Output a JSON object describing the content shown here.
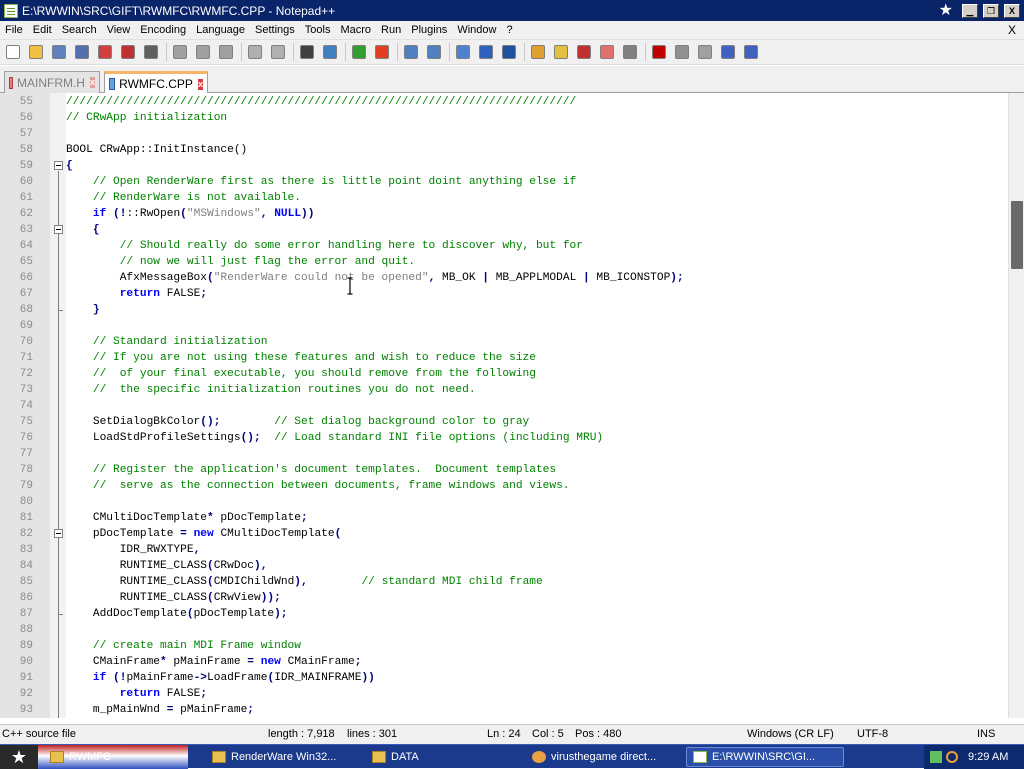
{
  "window": {
    "title": "E:\\RWWIN\\SRC\\GIFT\\RWMFC\\RWMFC.CPP - Notepad++",
    "close_glyph": "X"
  },
  "menu": [
    "File",
    "Edit",
    "Search",
    "View",
    "Encoding",
    "Language",
    "Settings",
    "Tools",
    "Macro",
    "Run",
    "Plugins",
    "Window",
    "?"
  ],
  "menu_close": "X",
  "toolbar_icons": [
    "new-file-icon",
    "open-file-icon",
    "save-icon",
    "save-all-icon",
    "close-icon",
    "close-all-icon",
    "print-icon",
    "cut-icon",
    "copy-icon",
    "paste-icon",
    "undo-icon",
    "redo-icon",
    "find-icon",
    "replace-icon",
    "zoom-in-icon",
    "zoom-out-icon",
    "sync-vertical-icon",
    "sync-horizontal-icon",
    "word-wrap-icon",
    "show-all-chars-icon",
    "indent-guide-icon",
    "user-define-language-icon",
    "doc-map-icon",
    "function-list-icon",
    "folder-as-workspace-icon",
    "monitoring-icon",
    "record-macro-icon",
    "stop-record-icon",
    "play-macro-icon",
    "play-multiple-icon",
    "save-macro-icon"
  ],
  "tabs": [
    {
      "label": "MAINFRM.H",
      "active": false
    },
    {
      "label": "RWMFC.CPP",
      "active": true
    }
  ],
  "lines": [
    {
      "n": "55",
      "parts": [
        [
          "c-comment",
          "////////////////////////////////////////////////////////////////////////////"
        ]
      ]
    },
    {
      "n": "56",
      "parts": [
        [
          "c-comment",
          "// CRwApp initialization"
        ]
      ]
    },
    {
      "n": "57",
      "parts": []
    },
    {
      "n": "58",
      "parts": [
        [
          "",
          "BOOL CRwApp::InitInstance()"
        ]
      ]
    },
    {
      "n": "59",
      "parts": [
        [
          "c-op",
          "{"
        ]
      ]
    },
    {
      "n": "60",
      "parts": [
        [
          "",
          "    "
        ],
        [
          "c-comment",
          "// Open RenderWare first as there is little point doint anything else if"
        ]
      ]
    },
    {
      "n": "61",
      "parts": [
        [
          "",
          "    "
        ],
        [
          "c-comment",
          "// RenderWare is not available."
        ]
      ]
    },
    {
      "n": "62",
      "parts": [
        [
          "",
          "    "
        ],
        [
          "c-keyword",
          "if"
        ],
        [
          "",
          " "
        ],
        [
          "c-op",
          "(!"
        ],
        [
          "",
          "::RwOpen"
        ],
        [
          "c-op",
          "("
        ],
        [
          "c-string",
          "\"MSWindows\""
        ],
        [
          "c-op",
          ","
        ],
        [
          "",
          " "
        ],
        [
          "c-keyword",
          "NULL"
        ],
        [
          "c-op",
          "))"
        ]
      ]
    },
    {
      "n": "63",
      "parts": [
        [
          "",
          "    "
        ],
        [
          "c-op",
          "{"
        ]
      ]
    },
    {
      "n": "64",
      "parts": [
        [
          "",
          "        "
        ],
        [
          "c-comment",
          "// Should really do some error handling here to discover why, but for"
        ]
      ]
    },
    {
      "n": "65",
      "parts": [
        [
          "",
          "        "
        ],
        [
          "c-comment",
          "// now we will just flag the error and quit."
        ]
      ]
    },
    {
      "n": "66",
      "parts": [
        [
          "",
          "        AfxMessageBox"
        ],
        [
          "c-op",
          "("
        ],
        [
          "c-string",
          "\"RenderWare could not be opened\""
        ],
        [
          "c-op",
          ","
        ],
        [
          "",
          " MB_OK "
        ],
        [
          "c-op",
          "|"
        ],
        [
          "",
          " MB_APPLMODAL "
        ],
        [
          "c-op",
          "|"
        ],
        [
          "",
          " MB_ICONSTOP"
        ],
        [
          "c-op",
          ");"
        ]
      ]
    },
    {
      "n": "67",
      "parts": [
        [
          "",
          "        "
        ],
        [
          "c-keyword",
          "return"
        ],
        [
          "",
          " FALSE"
        ],
        [
          "c-op",
          ";"
        ]
      ]
    },
    {
      "n": "68",
      "parts": [
        [
          "",
          "    "
        ],
        [
          "c-op",
          "}"
        ]
      ]
    },
    {
      "n": "69",
      "parts": []
    },
    {
      "n": "70",
      "parts": [
        [
          "",
          "    "
        ],
        [
          "c-comment",
          "// Standard initialization"
        ]
      ]
    },
    {
      "n": "71",
      "parts": [
        [
          "",
          "    "
        ],
        [
          "c-comment",
          "// If you are not using these features and wish to reduce the size"
        ]
      ]
    },
    {
      "n": "72",
      "parts": [
        [
          "",
          "    "
        ],
        [
          "c-comment",
          "//  of your final executable, you should remove from the following"
        ]
      ]
    },
    {
      "n": "73",
      "parts": [
        [
          "",
          "    "
        ],
        [
          "c-comment",
          "//  the specific initialization routines you do not need."
        ]
      ]
    },
    {
      "n": "74",
      "parts": []
    },
    {
      "n": "75",
      "parts": [
        [
          "",
          "    SetDialogBkColor"
        ],
        [
          "c-op",
          "();"
        ],
        [
          "",
          "        "
        ],
        [
          "c-comment",
          "// Set dialog background color to gray"
        ]
      ]
    },
    {
      "n": "76",
      "parts": [
        [
          "",
          "    LoadStdProfileSettings"
        ],
        [
          "c-op",
          "();"
        ],
        [
          "",
          "  "
        ],
        [
          "c-comment",
          "// Load standard INI file options (including MRU)"
        ]
      ]
    },
    {
      "n": "77",
      "parts": []
    },
    {
      "n": "78",
      "parts": [
        [
          "",
          "    "
        ],
        [
          "c-comment",
          "// Register the application's document templates.  Document templates"
        ]
      ]
    },
    {
      "n": "79",
      "parts": [
        [
          "",
          "    "
        ],
        [
          "c-comment",
          "//  serve as the connection between documents, frame windows and views."
        ]
      ]
    },
    {
      "n": "80",
      "parts": []
    },
    {
      "n": "81",
      "parts": [
        [
          "",
          "    CMultiDocTemplate"
        ],
        [
          "c-op",
          "*"
        ],
        [
          "",
          " pDocTemplate"
        ],
        [
          "c-op",
          ";"
        ]
      ]
    },
    {
      "n": "82",
      "parts": [
        [
          "",
          "    pDocTemplate "
        ],
        [
          "c-op",
          "="
        ],
        [
          "",
          " "
        ],
        [
          "c-keyword",
          "new"
        ],
        [
          "",
          " CMultiDocTemplate"
        ],
        [
          "c-op",
          "("
        ]
      ]
    },
    {
      "n": "83",
      "parts": [
        [
          "",
          "        IDR_RWXTYPE"
        ],
        [
          "c-op",
          ","
        ]
      ]
    },
    {
      "n": "84",
      "parts": [
        [
          "",
          "        RUNTIME_CLASS"
        ],
        [
          "c-op",
          "("
        ],
        [
          "",
          "CRwDoc"
        ],
        [
          "c-op",
          "),"
        ]
      ]
    },
    {
      "n": "85",
      "parts": [
        [
          "",
          "        RUNTIME_CLASS"
        ],
        [
          "c-op",
          "("
        ],
        [
          "",
          "CMDIChildWnd"
        ],
        [
          "c-op",
          "),"
        ],
        [
          "",
          "        "
        ],
        [
          "c-comment",
          "// standard MDI child frame"
        ]
      ]
    },
    {
      "n": "86",
      "parts": [
        [
          "",
          "        RUNTIME_CLASS"
        ],
        [
          "c-op",
          "("
        ],
        [
          "",
          "CRwView"
        ],
        [
          "c-op",
          "));"
        ]
      ]
    },
    {
      "n": "87",
      "parts": [
        [
          "",
          "    AddDocTemplate"
        ],
        [
          "c-op",
          "("
        ],
        [
          "",
          "pDocTemplate"
        ],
        [
          "c-op",
          ");"
        ]
      ]
    },
    {
      "n": "88",
      "parts": []
    },
    {
      "n": "89",
      "parts": [
        [
          "",
          "    "
        ],
        [
          "c-comment",
          "// create main MDI Frame window"
        ]
      ]
    },
    {
      "n": "90",
      "parts": [
        [
          "",
          "    CMainFrame"
        ],
        [
          "c-op",
          "*"
        ],
        [
          "",
          " pMainFrame "
        ],
        [
          "c-op",
          "="
        ],
        [
          "",
          " "
        ],
        [
          "c-keyword",
          "new"
        ],
        [
          "",
          " CMainFrame"
        ],
        [
          "c-op",
          ";"
        ]
      ]
    },
    {
      "n": "91",
      "parts": [
        [
          "",
          "    "
        ],
        [
          "c-keyword",
          "if"
        ],
        [
          "",
          " "
        ],
        [
          "c-op",
          "(!"
        ],
        [
          "",
          "pMainFrame"
        ],
        [
          "c-op",
          "->"
        ],
        [
          "",
          "LoadFrame"
        ],
        [
          "c-op",
          "("
        ],
        [
          "",
          "IDR_MAINFRAME"
        ],
        [
          "c-op",
          "))"
        ]
      ]
    },
    {
      "n": "92",
      "parts": [
        [
          "",
          "        "
        ],
        [
          "c-keyword",
          "return"
        ],
        [
          "",
          " FALSE"
        ],
        [
          "c-op",
          ";"
        ]
      ]
    },
    {
      "n": "93",
      "parts": [
        [
          "",
          "    m_pMainWnd "
        ],
        [
          "c-op",
          "="
        ],
        [
          "",
          " pMainFrame"
        ],
        [
          "c-op",
          ";"
        ]
      ]
    }
  ],
  "fold_markers": [
    "59",
    "63",
    "82"
  ],
  "statusbar": {
    "file_type": "C++ source file",
    "length": "length : 7,918",
    "lines": "lines : 301",
    "ln": "Ln : 24",
    "col": "Col : 5",
    "pos": "Pos : 480",
    "eol": "Windows (CR LF)",
    "encoding": "UTF-8",
    "mode": "INS"
  },
  "taskbar": {
    "tasks": [
      {
        "label": "RWMFC",
        "icon": "folder-icon"
      },
      {
        "label": "RenderWare Win32...",
        "icon": "folder-icon"
      },
      {
        "label": "DATA",
        "icon": "folder-icon"
      },
      {
        "label": "virusthegame direct...",
        "icon": "bug-icon"
      },
      {
        "label": "E:\\RWWIN\\SRC\\GI...",
        "icon": "np-icon"
      }
    ],
    "time": "9:29 AM"
  }
}
